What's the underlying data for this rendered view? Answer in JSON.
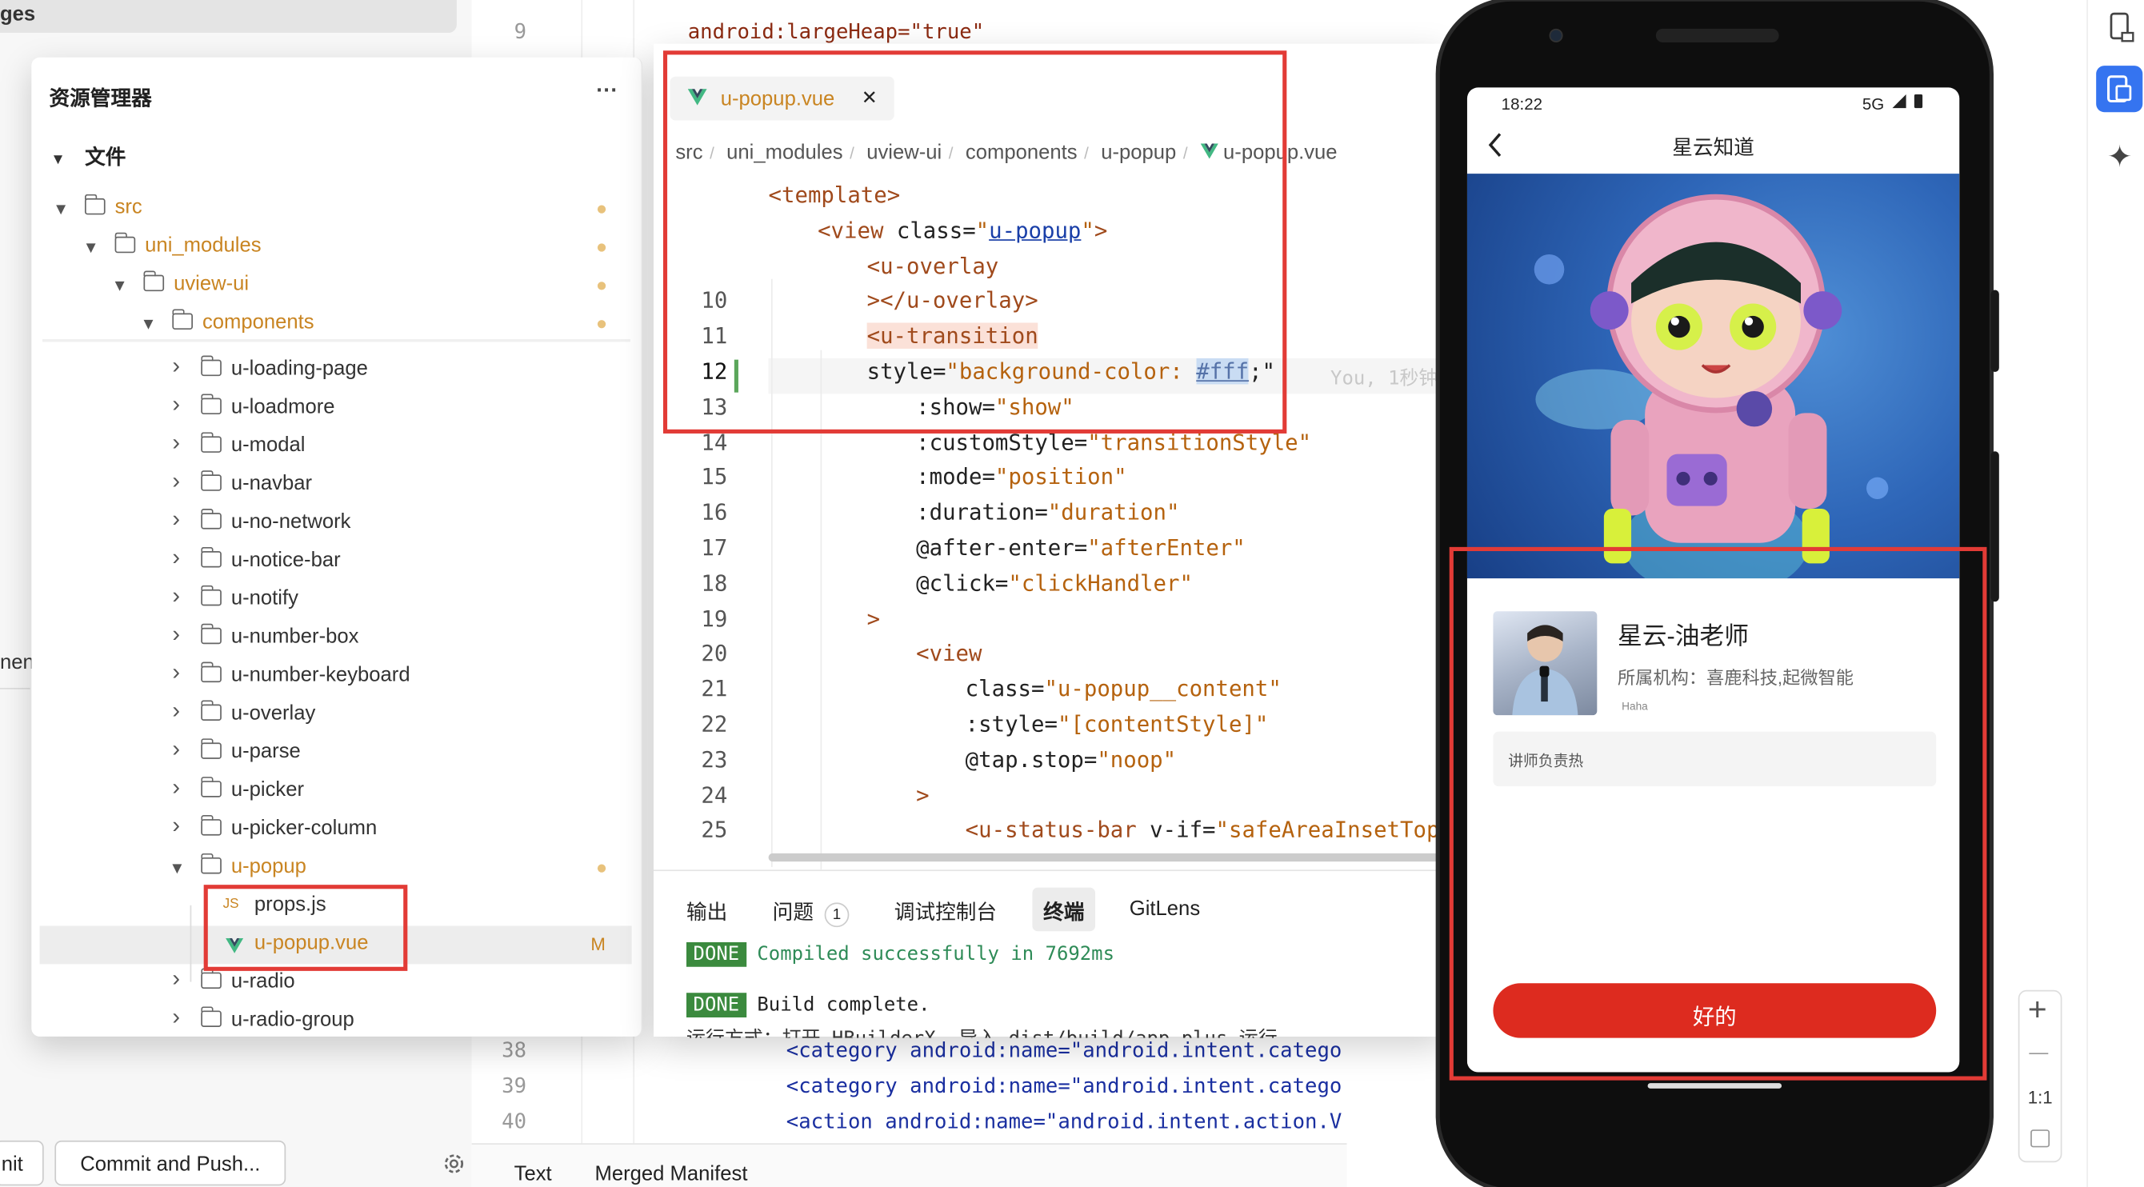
{
  "background_editor": {
    "top_tab_fragment": "ges",
    "top_line": {
      "number": "9",
      "code": "android:largeHeap=\"true\""
    },
    "lines": [
      {
        "number": "38",
        "code": "<category android:name=\"android.intent.catego"
      },
      {
        "number": "39",
        "code": "<category android:name=\"android.intent.catego"
      },
      {
        "number": "40",
        "code": "<action android:name=\"android.intent.action.V"
      }
    ],
    "bottom_tabs": [
      "Text",
      "Merged Manifest"
    ],
    "left_fragment_mid": "nenc",
    "left_fragment_bottom": "nit",
    "commit_button": "Commit and Push..."
  },
  "explorer": {
    "title": "资源管理器",
    "more": "···",
    "section": "文件",
    "tree": [
      {
        "label": "src",
        "depth": 0,
        "type": "folder",
        "open": true,
        "modified": true
      },
      {
        "label": "uni_modules",
        "depth": 1,
        "type": "folder",
        "open": true,
        "modified": true
      },
      {
        "label": "uview-ui",
        "depth": 2,
        "type": "folder",
        "open": true,
        "modified": true
      },
      {
        "label": "components",
        "depth": 3,
        "type": "folder",
        "open": true,
        "modified": true
      },
      {
        "label": "u-loading-page",
        "depth": 4,
        "type": "folder",
        "open": false
      },
      {
        "label": "u-loadmore",
        "depth": 4,
        "type": "folder",
        "open": false
      },
      {
        "label": "u-modal",
        "depth": 4,
        "type": "folder",
        "open": false
      },
      {
        "label": "u-navbar",
        "depth": 4,
        "type": "folder",
        "open": false
      },
      {
        "label": "u-no-network",
        "depth": 4,
        "type": "folder",
        "open": false
      },
      {
        "label": "u-notice-bar",
        "depth": 4,
        "type": "folder",
        "open": false
      },
      {
        "label": "u-notify",
        "depth": 4,
        "type": "folder",
        "open": false
      },
      {
        "label": "u-number-box",
        "depth": 4,
        "type": "folder",
        "open": false
      },
      {
        "label": "u-number-keyboard",
        "depth": 4,
        "type": "folder",
        "open": false
      },
      {
        "label": "u-overlay",
        "depth": 4,
        "type": "folder",
        "open": false
      },
      {
        "label": "u-parse",
        "depth": 4,
        "type": "folder",
        "open": false
      },
      {
        "label": "u-picker",
        "depth": 4,
        "type": "folder",
        "open": false
      },
      {
        "label": "u-picker-column",
        "depth": 4,
        "type": "folder",
        "open": false
      },
      {
        "label": "u-popup",
        "depth": 4,
        "type": "folder",
        "open": true,
        "modified": true
      },
      {
        "label": "props.js",
        "depth": 5,
        "type": "js",
        "badge": "JS"
      },
      {
        "label": "u-popup.vue",
        "depth": 5,
        "type": "vue",
        "selected": true,
        "status": "M"
      },
      {
        "label": "u-radio",
        "depth": 4,
        "type": "folder",
        "open": false
      },
      {
        "label": "u-radio-group",
        "depth": 4,
        "type": "folder",
        "open": false
      }
    ]
  },
  "editor": {
    "tab": {
      "name": "u-popup.vue",
      "close": "✕"
    },
    "breadcrumb": [
      "src",
      "uni_modules",
      "uview-ui",
      "components",
      "u-popup",
      "u-popup.vue"
    ],
    "breadcrumb_sep": "/",
    "lines": [
      {
        "number": "",
        "tokens": [
          {
            "k": "t",
            "v": "<template>"
          }
        ]
      },
      {
        "number": "",
        "tokens": [
          {
            "k": "t",
            "v": "<view "
          },
          {
            "k": "a",
            "v": "class="
          },
          {
            "k": "s",
            "v": "\""
          },
          {
            "k": "b",
            "v": "u-popup"
          },
          {
            "k": "s",
            "v": "\""
          },
          {
            "k": "t",
            "v": ">"
          }
        ]
      },
      {
        "number": "",
        "tokens": [
          {
            "k": "t",
            "v": "<u-overlay"
          }
        ]
      },
      {
        "number": "10",
        "tokens": [
          {
            "k": "t",
            "v": "></u-overlay>"
          }
        ]
      },
      {
        "number": "11",
        "tokens": [
          {
            "k": "t",
            "v": "<u-transition"
          }
        ]
      },
      {
        "number": "12",
        "tokens": [
          {
            "k": "a",
            "v": "style="
          },
          {
            "k": "s",
            "v": "\"background-color: "
          },
          {
            "k": "s",
            "v": "#fff"
          },
          {
            "k": "a",
            "v": ";\""
          }
        ]
      },
      {
        "number": "13",
        "tokens": [
          {
            "k": "a",
            "v": ":show="
          },
          {
            "k": "s",
            "v": "\"show\""
          }
        ]
      },
      {
        "number": "14",
        "tokens": [
          {
            "k": "a",
            "v": ":customStyle="
          },
          {
            "k": "s",
            "v": "\"transitionStyle\""
          }
        ]
      },
      {
        "number": "15",
        "tokens": [
          {
            "k": "a",
            "v": ":mode="
          },
          {
            "k": "s",
            "v": "\"position\""
          }
        ]
      },
      {
        "number": "16",
        "tokens": [
          {
            "k": "a",
            "v": ":duration="
          },
          {
            "k": "s",
            "v": "\"duration\""
          }
        ]
      },
      {
        "number": "17",
        "tokens": [
          {
            "k": "a",
            "v": "@after-enter="
          },
          {
            "k": "s",
            "v": "\"afterEnter\""
          }
        ]
      },
      {
        "number": "18",
        "tokens": [
          {
            "k": "a",
            "v": "@click="
          },
          {
            "k": "s",
            "v": "\"clickHandler\""
          }
        ]
      },
      {
        "number": "19",
        "tokens": [
          {
            "k": "t",
            "v": ">"
          }
        ]
      },
      {
        "number": "20",
        "tokens": [
          {
            "k": "t",
            "v": "<view"
          }
        ]
      },
      {
        "number": "21",
        "tokens": [
          {
            "k": "a",
            "v": "class="
          },
          {
            "k": "s",
            "v": "\"u-popup__content\""
          }
        ]
      },
      {
        "number": "22",
        "tokens": [
          {
            "k": "a",
            "v": ":style="
          },
          {
            "k": "s",
            "v": "\"[contentStyle]\""
          }
        ]
      },
      {
        "number": "23",
        "tokens": [
          {
            "k": "a",
            "v": "@tap.stop="
          },
          {
            "k": "s",
            "v": "\"noop\""
          }
        ]
      },
      {
        "number": "24",
        "tokens": [
          {
            "k": "t",
            "v": ">"
          }
        ]
      },
      {
        "number": "25",
        "tokens": [
          {
            "k": "t",
            "v": "<u-status-bar "
          },
          {
            "k": "a",
            "v": "v-if="
          },
          {
            "k": "s",
            "v": "\"safeAreaInsetTop\""
          },
          {
            "k": "t",
            "v": ">"
          }
        ]
      }
    ],
    "blame": "You, 1秒钟"
  },
  "panel": {
    "tabs": [
      "输出",
      "问题",
      "调试控制台",
      "终端",
      "GitLens"
    ],
    "problems_count": "1",
    "active_tab": "终端",
    "lines": [
      {
        "badge": "DONE",
        "text": "Compiled successfully in 7692ms"
      },
      {
        "badge": "DONE",
        "text": "Build complete."
      }
    ],
    "partial_line": "运行方式：打开 HBuilderX, 导入 dist/build/app-plus 运行。"
  },
  "phone": {
    "status_time": "18:22",
    "status_net": "5G",
    "nav_back": "<",
    "nav_title": "星云知道",
    "teacher_name": "星云-油老师",
    "org": "所属机构：喜鹿科技,起微智能",
    "small": "Haha",
    "input_placeholder": "讲师负责热",
    "ok_button": "好的"
  },
  "right_sidebar": {
    "ratio": "1:1",
    "plus": "+",
    "minus": "—"
  },
  "colors": {
    "highlight_red": "#e23b36",
    "vue_green": "#42b883",
    "ok_red": "#dd2b1f",
    "folder_orange": "#c98522"
  }
}
